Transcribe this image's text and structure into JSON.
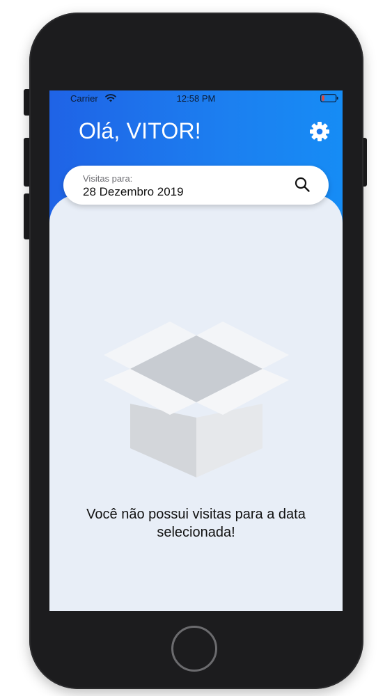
{
  "status_bar": {
    "carrier": "Carrier",
    "time": "12:58 PM"
  },
  "header": {
    "greeting": "Olá, VITOR!"
  },
  "search": {
    "label": "Visitas para:",
    "date_value": "28 Dezembro 2019"
  },
  "empty_state": {
    "message": "Você não possui visitas para a data selecionada!"
  },
  "colors": {
    "header_gradient_start": "#1f63e6",
    "header_gradient_end": "#168cf5",
    "content_background": "#e8eef7",
    "battery_low": "#e5483b"
  },
  "icons": {
    "settings": "gear-icon",
    "search": "search-icon",
    "empty": "empty-box-icon",
    "wifi": "wifi-icon",
    "battery": "battery-icon"
  }
}
